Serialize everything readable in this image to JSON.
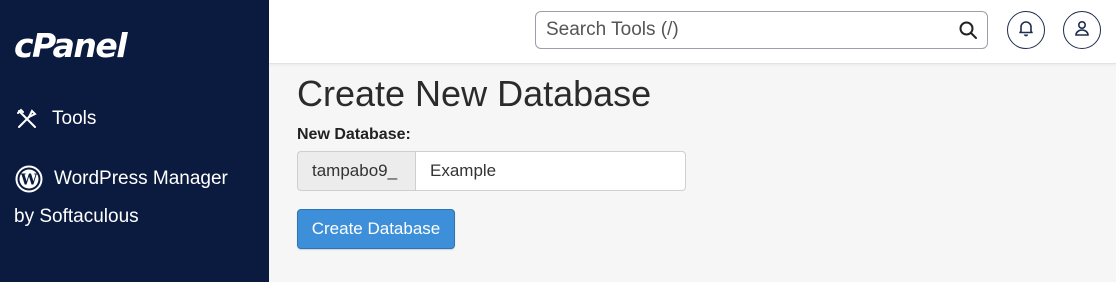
{
  "brand": {
    "logo_text": "cPanel"
  },
  "sidebar": {
    "items": [
      {
        "icon": "tools-icon",
        "label": "Tools"
      },
      {
        "icon": "wordpress-icon",
        "label": "WordPress Manager",
        "sublabel": "by Softaculous"
      }
    ]
  },
  "header": {
    "search": {
      "placeholder": "Search Tools (/)"
    },
    "icons": [
      "search-icon",
      "bell-icon",
      "user-icon"
    ]
  },
  "main": {
    "title": "Create New Database",
    "field_label": "New Database:",
    "prefix": "tampabo9_",
    "input_value": "Example",
    "submit_label": "Create Database"
  },
  "colors": {
    "sidebar_bg": "#0b1a3f",
    "primary_button": "#3c8fd8",
    "page_bg": "#f6f6f6"
  }
}
